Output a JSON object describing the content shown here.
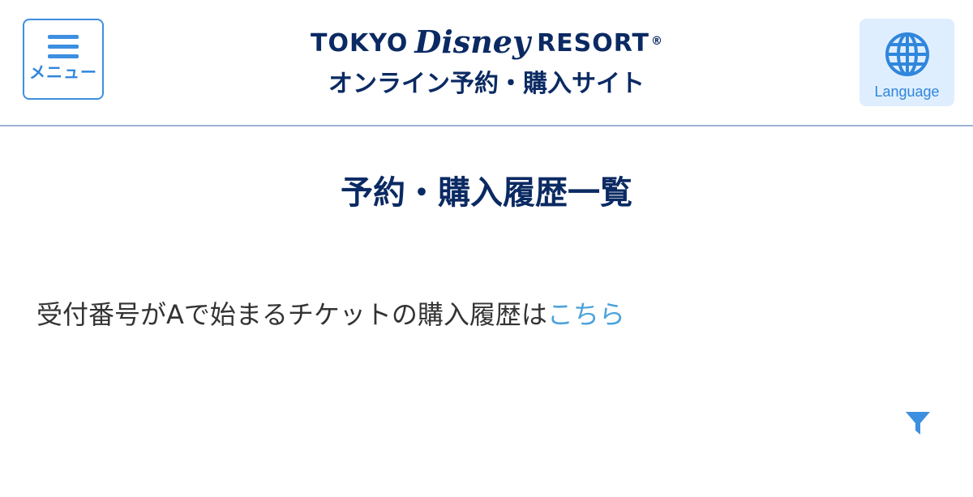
{
  "header": {
    "menu_label": "メニュー",
    "logo": {
      "line1_tokyo": "TOKYO",
      "line1_disney": "Disney",
      "line1_resort": "RESORT",
      "line1_registered": "®",
      "line2": "オンライン予約・購入サイト"
    },
    "language_label": "Language"
  },
  "main": {
    "page_title": "予約・購入履歴一覧",
    "notice_text": "受付番号がAで始まるチケットの購入履歴は",
    "notice_link": "こちら"
  },
  "colors": {
    "brand_navy": "#0b2a63",
    "accent_blue": "#2f86dc",
    "link_blue": "#4ba2db",
    "language_bg": "#dfeefe"
  },
  "icons": {
    "menu": "hamburger-icon",
    "language": "globe-icon",
    "filter": "filter-icon"
  }
}
